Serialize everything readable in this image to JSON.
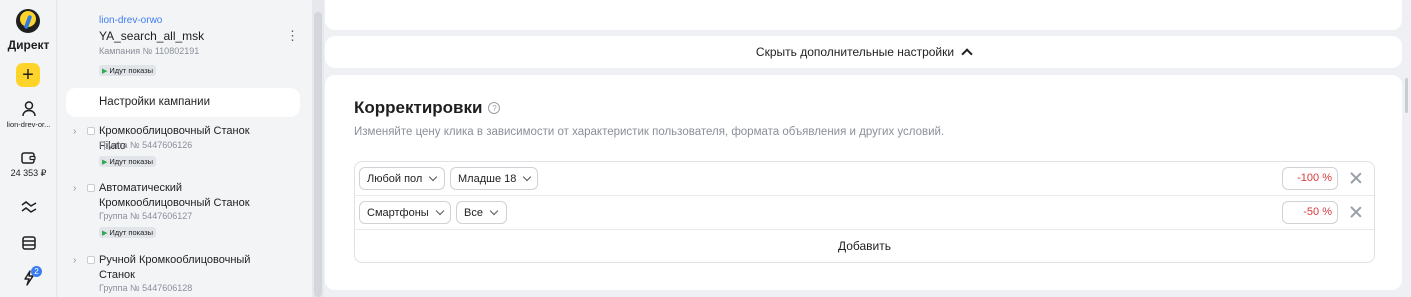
{
  "rail": {
    "brand": "Директ",
    "account_short": "lion-drev-or...",
    "balance": "24 353 ₽",
    "notifications": "2",
    "icons": [
      "yandex-logo-icon",
      "plus-icon",
      "user-icon",
      "wallet-icon",
      "trends-icon",
      "list-icon",
      "lightning-icon"
    ]
  },
  "tree": {
    "account": "lion-drev-orwo",
    "campaign": "YA_search_all_msk",
    "campaign_num": "Кампания № 110802191",
    "status": "Идут показы",
    "selected": "Настройки кампании",
    "groups": [
      {
        "name": "Кромкооблицовочный Станок Filato",
        "num": "Группа № 5447606126",
        "status": "Идут показы"
      },
      {
        "name": "Автоматический Кромкооблицовочный Станок",
        "num": "Группа № 5447606127",
        "status": "Идут показы"
      },
      {
        "name": "Ручной Кромкооблицовочный Станок",
        "num": "Группа № 5447606128",
        "status": ""
      }
    ]
  },
  "main": {
    "toggle_label": "Скрыть дополнительные настройки",
    "title": "Корректировки",
    "help": "?",
    "subtitle": "Изменяйте цену клика в зависимости от характеристик пользователя, формата объявления и других условий.",
    "rows": [
      {
        "sel1": "Любой пол",
        "sel2": "Младше 18",
        "pct": "-100 %"
      },
      {
        "sel1": "Смартфоны",
        "sel2": "Все",
        "pct": "-50 %"
      }
    ],
    "add_label": "Добавить"
  },
  "colors": {
    "accent": "#3d7df2",
    "brand_yellow": "#fed42b",
    "negative": "#d8393b",
    "status_green": "#2fa84f"
  }
}
